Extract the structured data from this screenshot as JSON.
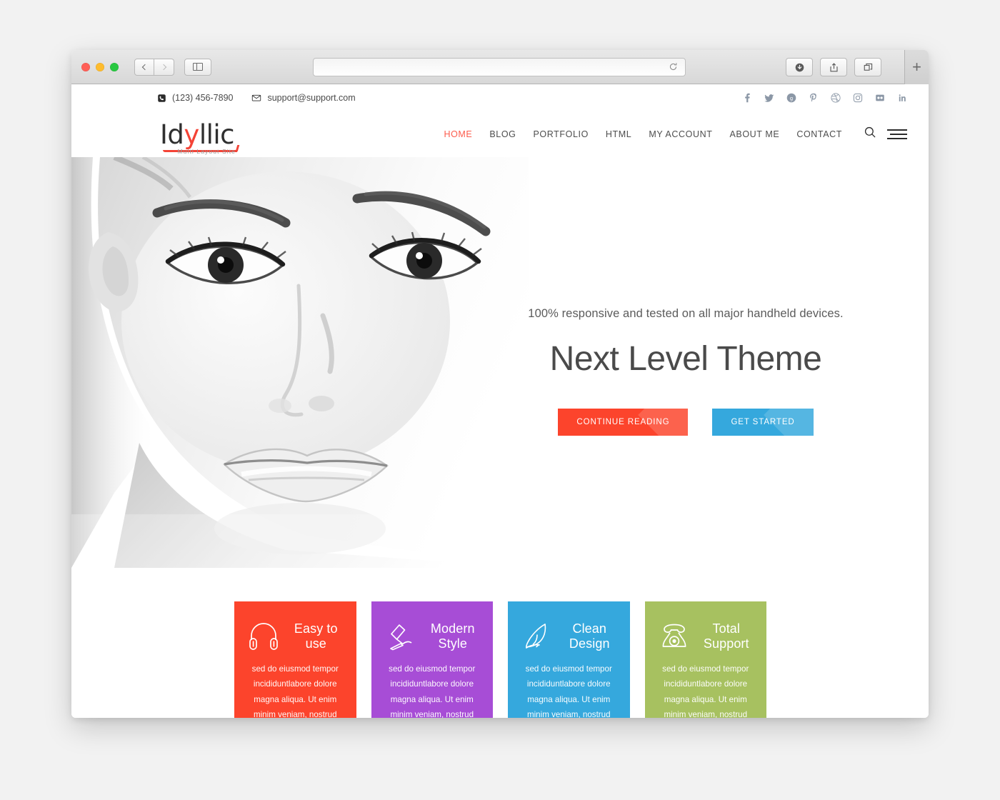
{
  "browser": {
    "url_value": "",
    "url_placeholder": "",
    "reload_icon": "reload-icon",
    "back_icon": "back-chevron-icon",
    "forward_icon": "forward-chevron-icon",
    "sidebar_icon": "sidebar-toggle-icon",
    "downloads_icon": "downloads-icon",
    "share_icon": "share-icon",
    "tabs_icon": "show-tabs-icon",
    "new_tab_label": "+"
  },
  "topbar": {
    "phone": "(123) 456-7890",
    "email": "support@support.com",
    "phone_icon": "phone-icon",
    "email_icon": "envelope-icon",
    "socials": [
      {
        "name": "facebook",
        "label": "f"
      },
      {
        "name": "twitter",
        "label": "t"
      },
      {
        "name": "google-plus",
        "label": "g+"
      },
      {
        "name": "pinterest",
        "label": "p"
      },
      {
        "name": "dribbble",
        "label": "d"
      },
      {
        "name": "instagram",
        "label": "ig"
      },
      {
        "name": "flickr",
        "label": "fl"
      },
      {
        "name": "linkedin",
        "label": "in"
      }
    ]
  },
  "header": {
    "logo_part1": "Id",
    "logo_y": "y",
    "logo_part2": "llic",
    "logo_tagline": "Multi Layout Site",
    "nav": [
      {
        "label": "HOME",
        "active": true
      },
      {
        "label": "BLOG",
        "active": false
      },
      {
        "label": "PORTFOLIO",
        "active": false
      },
      {
        "label": "HTML",
        "active": false
      },
      {
        "label": "MY ACCOUNT",
        "active": false
      },
      {
        "label": "ABOUT ME",
        "active": false
      },
      {
        "label": "CONTACT",
        "active": false
      }
    ],
    "search_icon": "search-icon",
    "menu_icon": "hamburger-menu-icon",
    "active_color": "#fc5c4c"
  },
  "hero": {
    "subtitle": "100% responsive and tested on all major handheld devices.",
    "title": "Next Level Theme",
    "primary_button": "CONTINUE READING",
    "secondary_button": "GET STARTED",
    "primary_color": "#fc442c",
    "secondary_color": "#35a8dd",
    "image_alt": "black-and-white portrait of a woman's face"
  },
  "features": [
    {
      "icon": "headphones-icon",
      "title": "Easy to use",
      "body": "sed do eiusmod tempor incididuntlabore dolore magna aliqua. Ut enim minim veniam, nostrud exercitation.",
      "color": "#fc442c"
    },
    {
      "icon": "desk-lamp-icon",
      "title": "Modern Style",
      "body": "sed do eiusmod tempor incididuntlabore dolore magna aliqua. Ut enim minim veniam, nostrud exercitation.",
      "color": "#a74dd6"
    },
    {
      "icon": "quill-pen-icon",
      "title": "Clean Design",
      "body": "sed do eiusmod tempor incididuntlabore dolore magna aliqua. Ut enim minim veniam, nostrud exercitation.",
      "color": "#35a8dd"
    },
    {
      "icon": "telephone-icon",
      "title": "Total Support",
      "body": "sed do eiusmod tempor incididuntlabore dolore magna aliqua. Ut enim minim veniam, nostrud exercitation.",
      "color": "#a7c160"
    }
  ]
}
